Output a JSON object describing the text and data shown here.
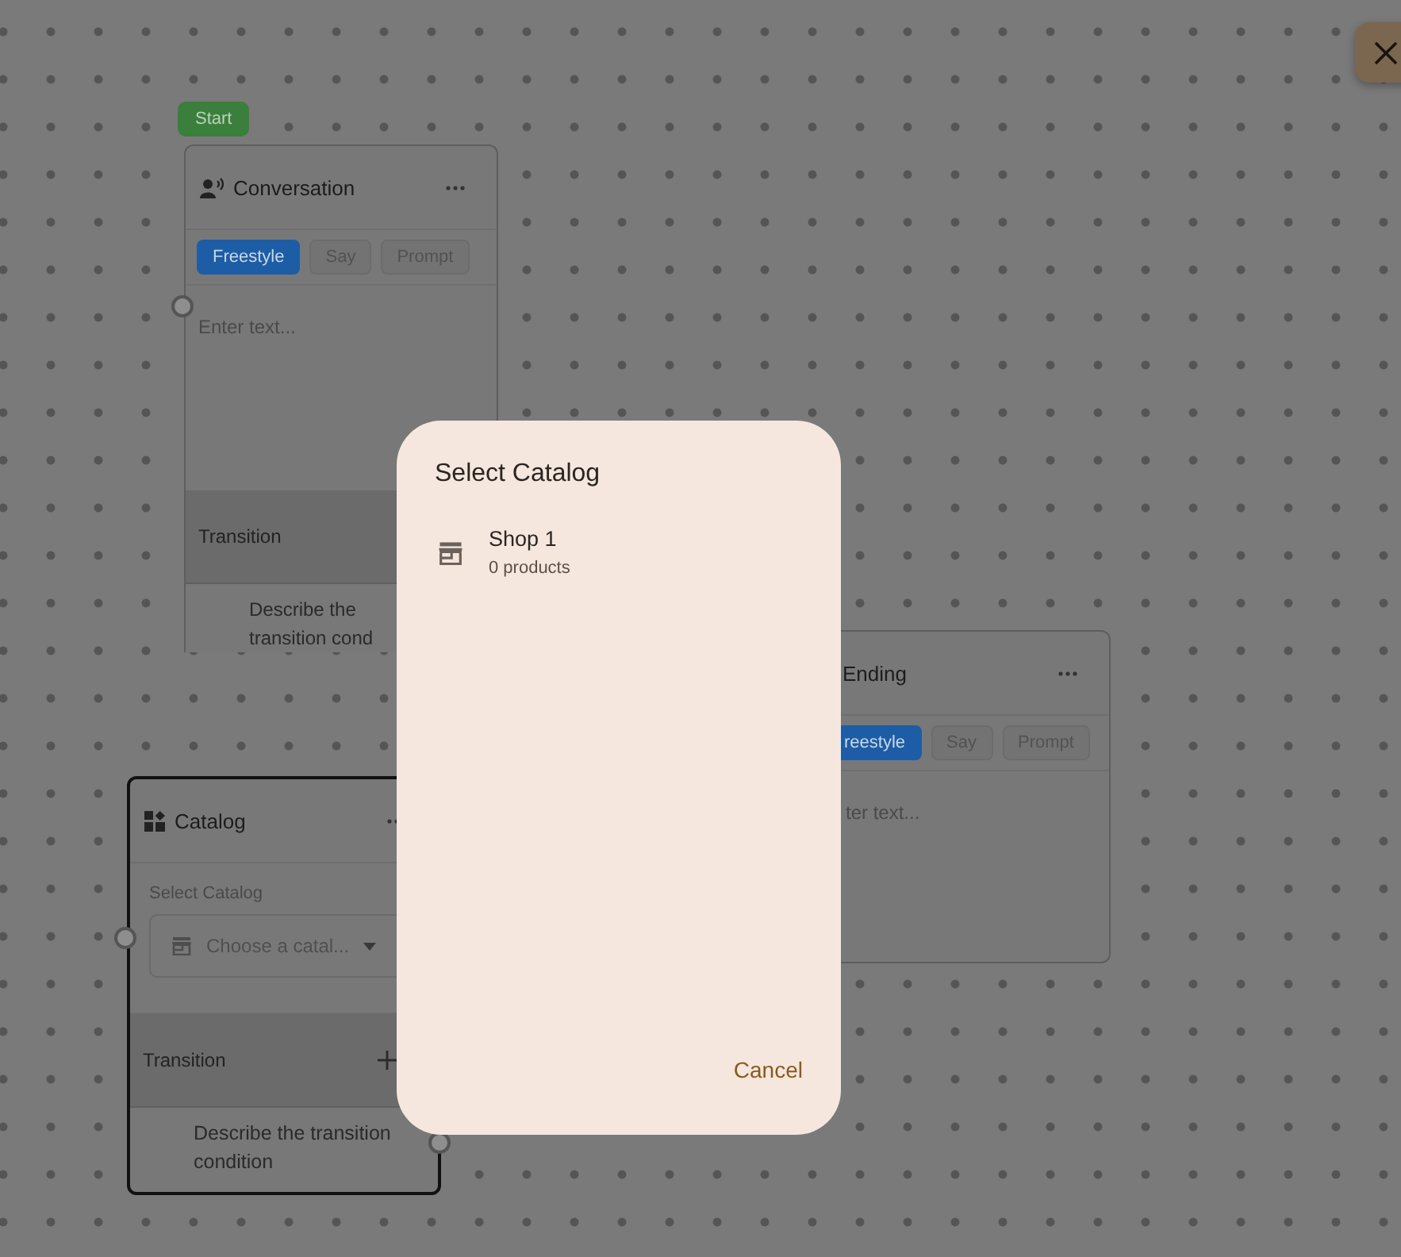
{
  "nodes": [
    {
      "kind": "conversation",
      "badge": "Start",
      "title": "Conversation",
      "tabs": [
        {
          "label": "Freestyle",
          "selected": true
        },
        {
          "label": "Say",
          "selected": false
        },
        {
          "label": "Prompt",
          "selected": false
        }
      ],
      "placeholder": "Enter text...",
      "transition_label": "Transition",
      "transition_text": "Describe the transition cond"
    },
    {
      "kind": "ending",
      "title": "Ending",
      "tabs": [
        {
          "label": "reestyle",
          "selected": true
        },
        {
          "label": "Say",
          "selected": false
        },
        {
          "label": "Prompt",
          "selected": false
        }
      ],
      "placeholder": "ter text..."
    },
    {
      "kind": "catalog",
      "title": "Catalog",
      "selected": true,
      "field_label": "Select Catalog",
      "select_placeholder": "Choose a catal...",
      "transition_label": "Transition",
      "transition_text": "Describe the transition condition"
    }
  ],
  "dialog": {
    "title": "Select Catalog",
    "items": [
      {
        "name": "Shop 1",
        "detail": "0 products"
      }
    ],
    "cancel": "Cancel"
  }
}
